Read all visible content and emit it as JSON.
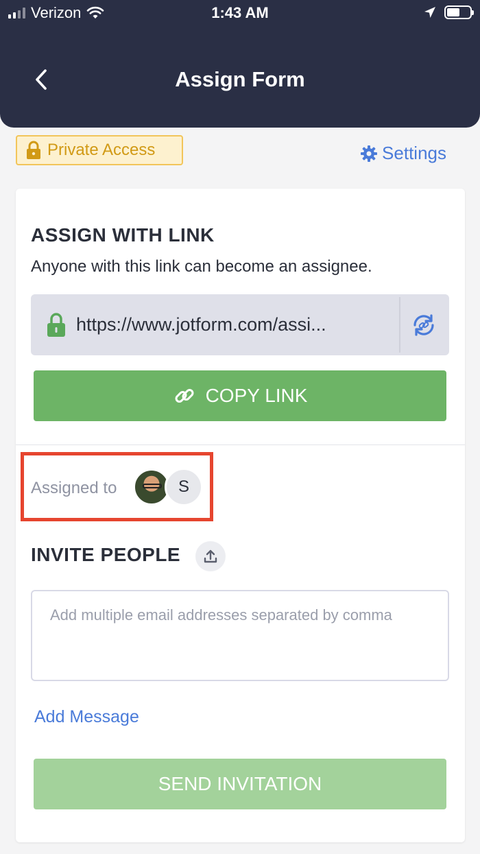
{
  "status_bar": {
    "carrier": "Verizon",
    "time": "1:43 AM"
  },
  "header": {
    "title": "Assign Form"
  },
  "access": {
    "badge_label": "Private Access",
    "settings_label": "Settings"
  },
  "assign_link": {
    "title": "ASSIGN WITH LINK",
    "description": "Anyone with this link can become an assignee.",
    "url": "https://www.jotform.com/assi...",
    "copy_label": "COPY LINK"
  },
  "assigned": {
    "label": "Assigned to",
    "assignee_initial": "S"
  },
  "invite": {
    "title": "INVITE PEOPLE",
    "email_placeholder": "Add multiple email addresses separated by comma",
    "add_message_label": "Add Message",
    "send_label": "SEND INVITATION"
  },
  "colors": {
    "header_bg": "#2a2f45",
    "accent_blue": "#4a7bd9",
    "copy_green": "#6db466",
    "send_green_disabled": "#a3d29b",
    "badge_yellow": "#f2c55a",
    "highlight_red": "#e6452f"
  },
  "icons": [
    "signal-icon",
    "wifi-icon",
    "location-arrow-icon",
    "battery-icon",
    "back-chevron-icon",
    "lock-icon",
    "gear-icon",
    "refresh-link-icon",
    "link-icon",
    "upload-icon"
  ]
}
